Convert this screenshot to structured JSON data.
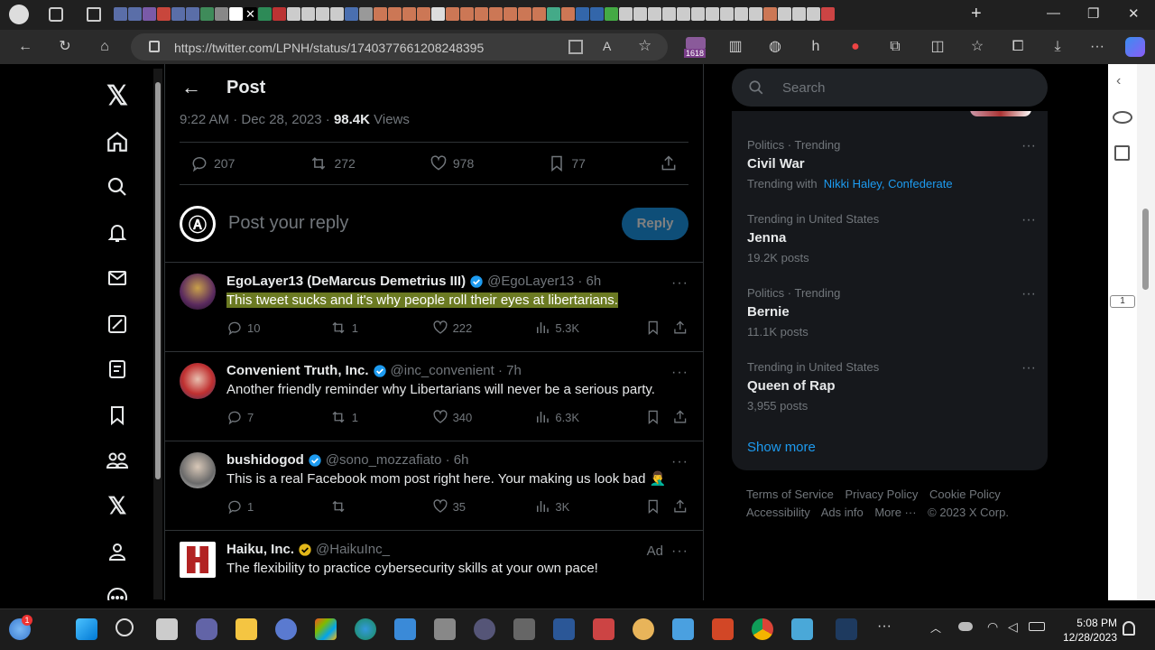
{
  "browser": {
    "url": "https://twitter.com/LPNH/status/1740377661208248395",
    "badge_count": "1618"
  },
  "post_header": {
    "title": "Post"
  },
  "post_meta": {
    "timestamp": "9:22 AM · Dec 28, 2023 ·",
    "views_count": "98.4K",
    "views_label": "Views"
  },
  "post_stats": {
    "replies": "207",
    "reposts": "272",
    "likes": "978",
    "bookmarks": "77"
  },
  "reply_box": {
    "placeholder": "Post your reply",
    "button": "Reply"
  },
  "tweets": [
    {
      "name": "EgoLayer13 (DeMarcus Demetrius III)",
      "handle": "@EgoLayer13 · 6h",
      "text": "This tweet sucks and it's why people roll their eyes at libertarians.",
      "replies": "10",
      "reposts": "1",
      "likes": "222",
      "views": "5.3K"
    },
    {
      "name": "Convenient Truth, Inc.",
      "handle": "@inc_convenient · 7h",
      "text": "Another friendly reminder why Libertarians will never be a serious party.",
      "replies": "7",
      "reposts": "1",
      "likes": "340",
      "views": "6.3K"
    },
    {
      "name": "bushidogod",
      "handle": "@sono_mozzafiato · 6h",
      "text": "This is a real Facebook mom post right here. Your making us look bad 🤦‍♂️",
      "replies": "1",
      "reposts": "",
      "likes": "35",
      "views": "3K"
    },
    {
      "name": "Haiku, Inc.",
      "handle": "@HaikuInc_",
      "ad_label": "Ad",
      "text": "The flexibility to practice cybersecurity skills at your own pace!"
    }
  ],
  "search": {
    "placeholder": "Search"
  },
  "trends": [
    {
      "category": "Politics · Trending",
      "name": "Civil War",
      "sub_prefix": "Trending with",
      "sub_links": "Nikki Haley, Confederate"
    },
    {
      "category": "Trending in United States",
      "name": "Jenna",
      "sub": "19.2K posts"
    },
    {
      "category": "Politics · Trending",
      "name": "Bernie",
      "sub": "11.1K posts"
    },
    {
      "category": "Trending in United States",
      "name": "Queen of Rap",
      "sub": "3,955 posts"
    }
  ],
  "show_more": "Show more",
  "footer": {
    "terms": "Terms of Service",
    "privacy": "Privacy Policy",
    "cookie": "Cookie Policy",
    "accessibility": "Accessibility",
    "ads": "Ads info",
    "more": "More ···",
    "copyright": "© 2023 X Corp."
  },
  "side_badge": "1",
  "taskbar": {
    "time": "5:08 PM",
    "date": "12/28/2023",
    "weather_badge": "1"
  },
  "colors": {
    "accent": "#1d9bf0",
    "highlight": "#6b7a22",
    "background": "#000000"
  }
}
